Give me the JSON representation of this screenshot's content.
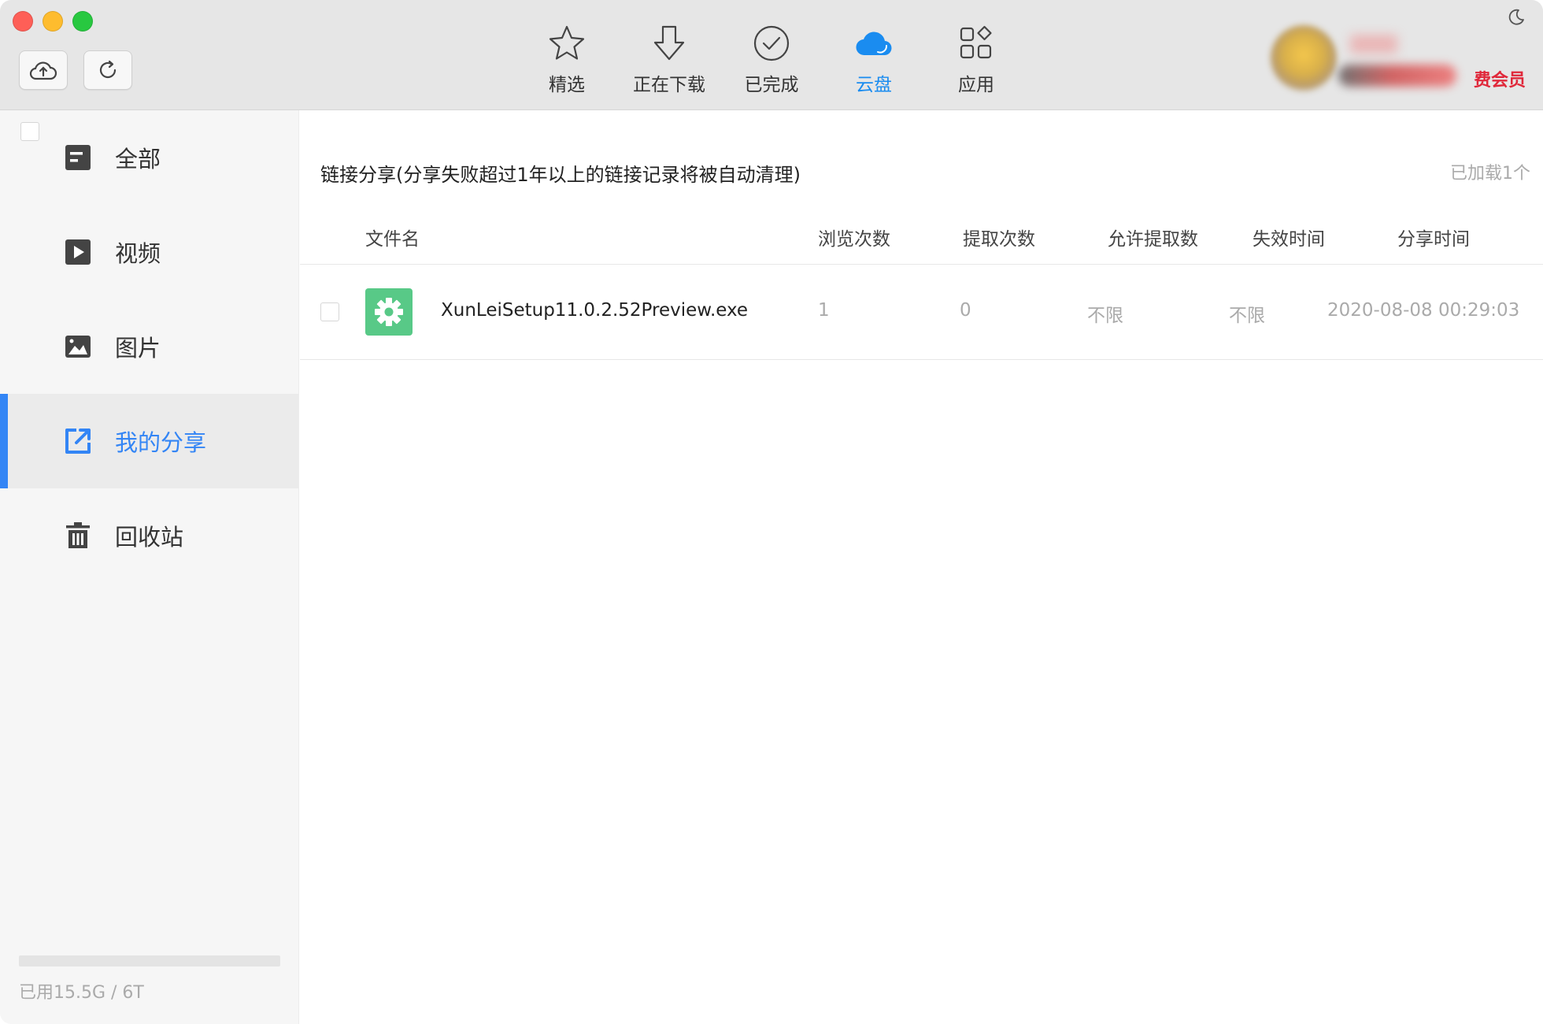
{
  "toolbar": {
    "nav": [
      {
        "label": "精选",
        "icon": "star-icon"
      },
      {
        "label": "正在下载",
        "icon": "download-arrow-icon"
      },
      {
        "label": "已完成",
        "icon": "check-circle-icon"
      },
      {
        "label": "云盘",
        "icon": "cloud-icon",
        "active": true
      },
      {
        "label": "应用",
        "icon": "apps-grid-icon"
      }
    ],
    "member_label": "费会员"
  },
  "sidebar": {
    "items": [
      {
        "label": "全部",
        "icon": "all-files-icon"
      },
      {
        "label": "视频",
        "icon": "video-icon"
      },
      {
        "label": "图片",
        "icon": "image-icon"
      },
      {
        "label": "我的分享",
        "icon": "share-icon",
        "active": true
      },
      {
        "label": "回收站",
        "icon": "trash-icon"
      }
    ],
    "storage_text": "已用15.5G / 6T"
  },
  "main": {
    "title": "链接分享(分享失败超过1年以上的链接记录将被自动清理)",
    "loaded_text": "已加载1个",
    "columns": [
      "文件名",
      "浏览次数",
      "提取次数",
      "允许提取数",
      "失效时间",
      "分享时间"
    ],
    "rows": [
      {
        "file_name": "XunLeiSetup11.0.2.52Preview.exe",
        "views": "1",
        "extracts": "0",
        "allowed": "不限",
        "expire": "不限",
        "share_time": "2020-08-08 00:29:03"
      }
    ]
  },
  "colors": {
    "accent": "#3385f5",
    "nav_active": "#1a8cf0",
    "member_red": "#e0283a",
    "file_icon_green": "#58c987"
  }
}
